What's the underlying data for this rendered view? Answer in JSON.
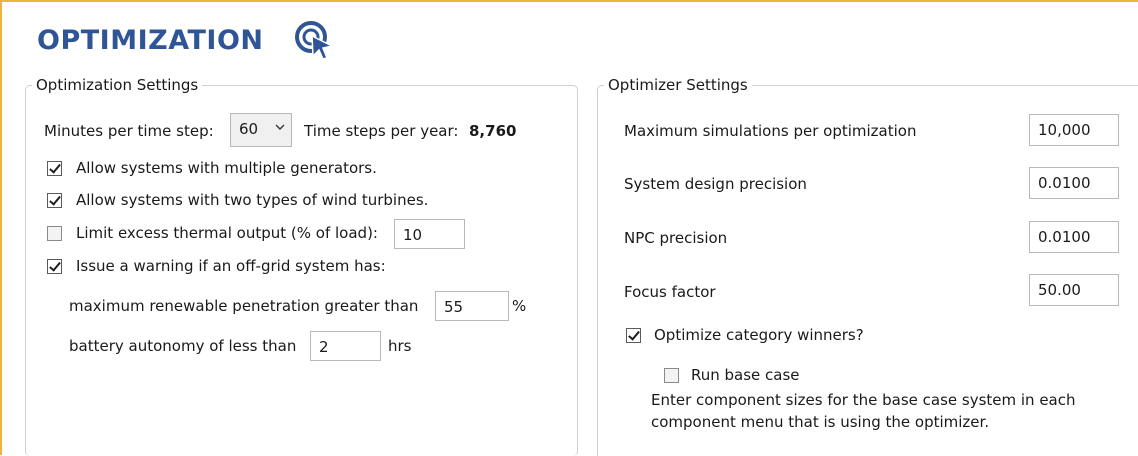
{
  "page": {
    "title": "OPTIMIZATION"
  },
  "optimization_settings": {
    "legend": "Optimization Settings",
    "minutes_label": "Minutes per time step:",
    "minutes_value": "60",
    "timesteps_label": "Time steps per year:",
    "timesteps_value": "8,760",
    "allow_multiple_generators": {
      "label": "Allow systems with multiple generators.",
      "checked": true
    },
    "allow_two_wind": {
      "label": "Allow systems with two types of wind turbines.",
      "checked": true
    },
    "limit_excess_thermal": {
      "label": "Limit excess thermal output (% of load):",
      "checked": false,
      "value": "10"
    },
    "issue_warning": {
      "label": "Issue a warning if an off-grid system has:",
      "checked": true
    },
    "max_renewable_label": "maximum renewable penetration greater than",
    "max_renewable_value": "55",
    "max_renewable_unit": "%",
    "battery_autonomy_label": "battery autonomy of less than",
    "battery_autonomy_value": "2",
    "battery_autonomy_unit": "hrs"
  },
  "optimizer_settings": {
    "legend": "Optimizer Settings",
    "max_simulations": {
      "label": "Maximum simulations per optimization",
      "value": "10,000"
    },
    "system_precision": {
      "label": "System design precision",
      "value": "0.0100"
    },
    "npc_precision": {
      "label": "NPC precision",
      "value": "0.0100"
    },
    "focus_factor": {
      "label": "Focus factor",
      "value": "50.00"
    },
    "optimize_category_winners": {
      "label": "Optimize category winners?",
      "checked": true
    },
    "run_base_case": {
      "label": "Run base case",
      "checked": false
    },
    "base_case_note_line1": "Enter component sizes for the base case system in each",
    "base_case_note_line2": "component menu that is using the optimizer."
  },
  "colors": {
    "title": "#2f5597",
    "frame_accent": "#f0b43c",
    "icon": "#2f5597"
  },
  "icons": {
    "title_icon": "target-cursor-icon",
    "dropdown": "chevron-down-icon"
  }
}
